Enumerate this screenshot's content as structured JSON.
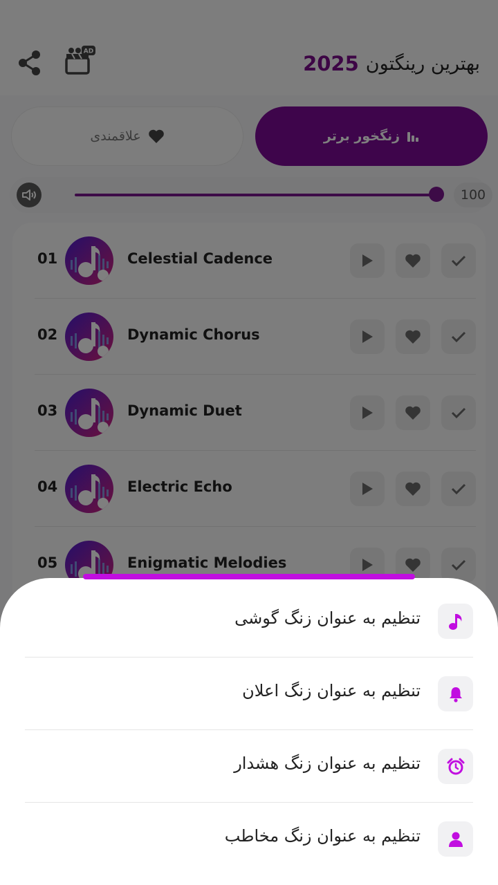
{
  "header": {
    "title_text": "بهترین رینگتون",
    "title_year": "2025",
    "ad_badge": "AD",
    "share_icon": "share-icon",
    "ad_icon": "ad-clapper-icon"
  },
  "tabs": [
    {
      "label": "زنگخور برتر",
      "icon": "bar-chart-icon",
      "active": true
    },
    {
      "label": "علاقمندی",
      "icon": "heart-icon",
      "active": false
    }
  ],
  "volume": {
    "value": "100",
    "level_percent": 100,
    "icon": "speaker-icon"
  },
  "songs": [
    {
      "number": "01",
      "title": "Celestial Cadence"
    },
    {
      "number": "02",
      "title": "Dynamic Chorus"
    },
    {
      "number": "03",
      "title": "Dynamic Duet"
    },
    {
      "number": "04",
      "title": "Electric Echo"
    },
    {
      "number": "05",
      "title": "Enigmatic Melodies"
    }
  ],
  "sheet": {
    "options": [
      {
        "label": "تنظیم به عنوان زنگ گوشی",
        "icon": "music-note-icon"
      },
      {
        "label": "تنظیم به عنوان زنگ اعلان",
        "icon": "bell-icon"
      },
      {
        "label": "تنظیم به عنوان زنگ هشدار",
        "icon": "alarm-clock-icon"
      },
      {
        "label": "تنظیم به عنوان زنگ مخاطب",
        "icon": "contact-person-icon"
      }
    ]
  },
  "colors": {
    "accent": "#7c0b96",
    "sheet_icon": "#c10ee0",
    "overlay": "#000000"
  }
}
